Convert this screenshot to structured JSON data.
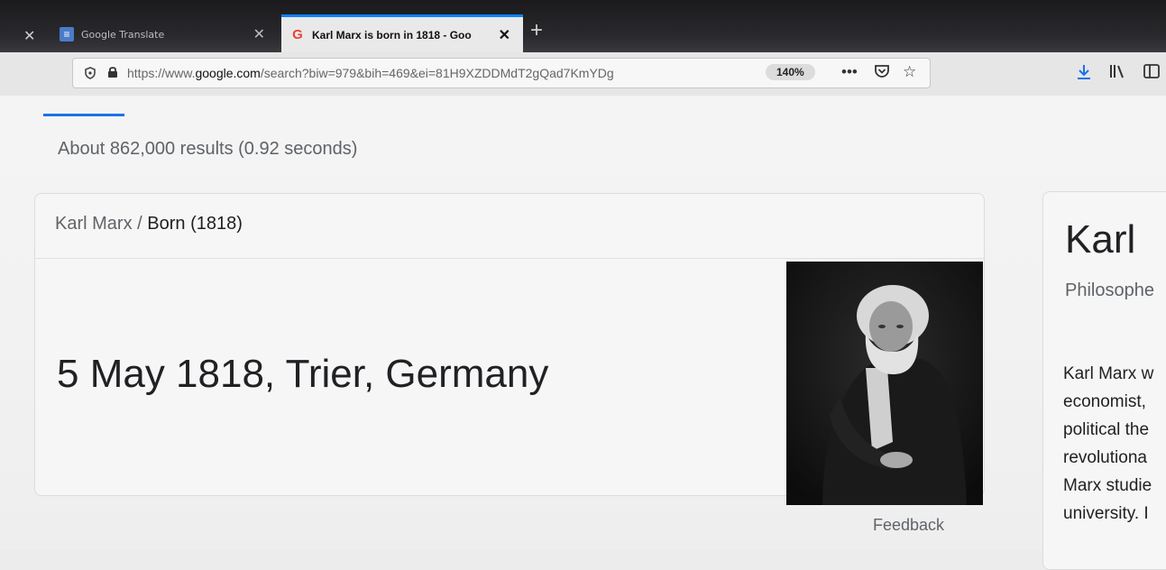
{
  "browser": {
    "tabs": [
      {
        "title": "Google Translate",
        "active": false
      },
      {
        "title": "Karl Marx is born in 1818 - Goo",
        "active": true
      }
    ],
    "url_prefix": "https://www.",
    "url_domain": "google.com",
    "url_rest": "/search?biw=979&bih=469&ei=81H9XZDDMdT2gQad7KmYDg",
    "zoom": "140%",
    "icons": [
      "shield-icon",
      "lock-icon",
      "more-icon",
      "pocket-icon",
      "star-icon",
      "download-icon",
      "library-icon",
      "sidebar-icon"
    ]
  },
  "search": {
    "results_count": "About 862,000 results (0.92 seconds)"
  },
  "answer_card": {
    "crumb_entity": "Karl Marx",
    "crumb_sep": "/",
    "crumb_attr": "Born (1818)",
    "answer": "5 May 1818, Trier, Germany",
    "feedback": "Feedback"
  },
  "knowledge_panel": {
    "title": "Karl",
    "subtitle": "Philosophe",
    "description_lines": [
      "Karl Marx w",
      "economist,",
      "political the",
      "revolutiona",
      "Marx studie",
      "university. I"
    ]
  }
}
